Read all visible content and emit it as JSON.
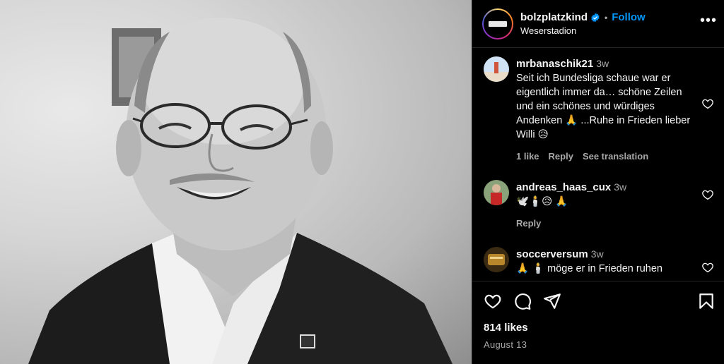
{
  "post": {
    "username": "bolzplatzkind",
    "location": "Weserstadion",
    "follow_label": "Follow",
    "dot": "•",
    "likes": "814 likes",
    "date": "August 13"
  },
  "comments": [
    {
      "user": "mrbanaschik21",
      "time": "3w",
      "text": "Seit ich Bundesliga schaue war er eigentlich immer da… schöne Zeilen und ein schönes und würdiges Andenken 🙏 ...Ruhe in Frieden lieber Willi 😥",
      "likes_label": "1 like",
      "reply_label": "Reply",
      "translate_label": "See translation"
    },
    {
      "user": "andreas_haas_cux",
      "time": "3w",
      "text": "🕊️🕯️😥 🙏",
      "reply_label": "Reply"
    },
    {
      "user": "soccerversum",
      "time": "3w",
      "text": "🙏 🕯️ möge er in Frieden ruhen"
    }
  ],
  "icons": {
    "verified": "verified-badge-icon",
    "more": "more-options-icon",
    "like": "heart-icon",
    "comment": "comment-icon",
    "share": "share-icon",
    "save": "bookmark-icon"
  },
  "colors": {
    "accent": "#0095f6",
    "background": "#000000",
    "muted": "#a8a8a8",
    "divider": "#262626"
  }
}
